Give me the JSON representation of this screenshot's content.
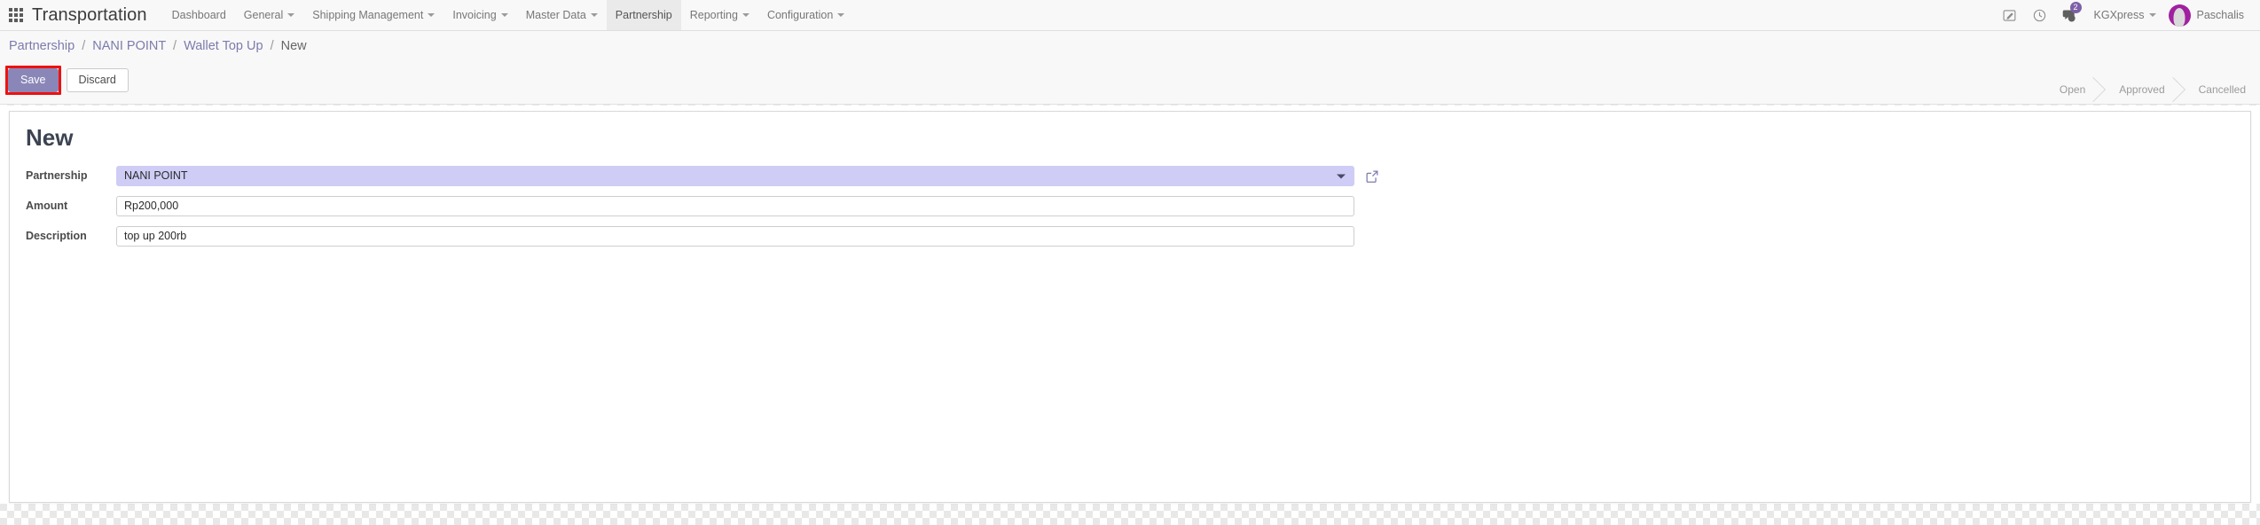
{
  "navbar": {
    "apps_icon": "apps-grid-icon",
    "brand": "Transportation",
    "menu_items": [
      {
        "label": "Dashboard",
        "has_caret": false,
        "active": false
      },
      {
        "label": "General",
        "has_caret": true,
        "active": false
      },
      {
        "label": "Shipping Management",
        "has_caret": true,
        "active": false
      },
      {
        "label": "Invoicing",
        "has_caret": true,
        "active": false
      },
      {
        "label": "Master Data",
        "has_caret": true,
        "active": false
      },
      {
        "label": "Partnership",
        "has_caret": false,
        "active": true
      },
      {
        "label": "Reporting",
        "has_caret": true,
        "active": false
      },
      {
        "label": "Configuration",
        "has_caret": true,
        "active": false
      }
    ],
    "right": {
      "edit_icon": "edit-pencil-icon",
      "activity_icon": "clock-icon",
      "messages_icon": "chat-bubble-icon",
      "messages_badge": "2",
      "company": "KGXpress",
      "user_name": "Paschalis",
      "avatar_icon": "user-avatar",
      "accent_color": "#7c5fa8",
      "avatar_color": "#a020a0"
    }
  },
  "breadcrumb": {
    "items": [
      {
        "label": "Partnership",
        "link": true
      },
      {
        "label": "NANI POINT",
        "link": true
      },
      {
        "label": "Wallet Top Up",
        "link": true
      },
      {
        "label": "New",
        "link": false
      }
    ],
    "separator": "/"
  },
  "buttons": {
    "save_label": "Save",
    "discard_label": "Discard",
    "save_highlight_color": "#ee1111",
    "save_bg_color": "#8a87b8"
  },
  "statusbar": {
    "steps": [
      "Open",
      "Approved",
      "Cancelled"
    ]
  },
  "form": {
    "title": "New",
    "fields": [
      {
        "label": "Partnership",
        "value": "NANI POINT",
        "placeholder": "",
        "type": "many2one",
        "highlight_color": "#cfccf5",
        "caret_icon": "chevron-down-icon",
        "external_icon": "external-link-icon"
      },
      {
        "label": "Amount",
        "value": "Rp200,000",
        "placeholder": "",
        "type": "text"
      },
      {
        "label": "Description",
        "value": "top up 200rb",
        "placeholder": "",
        "type": "text"
      }
    ]
  }
}
